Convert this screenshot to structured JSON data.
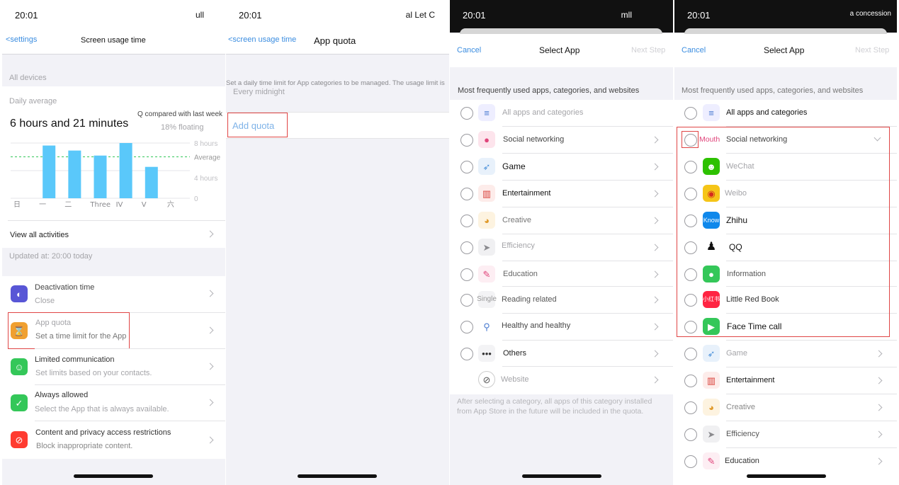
{
  "screen1": {
    "time": "20:01",
    "signal": "ull",
    "back_label": "<settings",
    "title": "Screen usage time",
    "section_label": "All devices",
    "daily_average_label": "Daily average",
    "compare_label": "Q compared with last week",
    "total_time": "6 hours and 21 minutes",
    "floating_label": "18% floating",
    "view_all_label": "View all activities",
    "updated_label": "Updated at: 20:00 today",
    "items": [
      {
        "title": "Deactivation time",
        "subtitle": "Close"
      },
      {
        "title": "App quota",
        "subtitle": "Set a time limit for the App"
      },
      {
        "title": "Limited communication",
        "subtitle": "Set limits based on your contacts."
      },
      {
        "title": "Always allowed",
        "subtitle": "Select the App that is always available."
      },
      {
        "title": "Content and privacy access restrictions",
        "subtitle": "Block inappropriate content."
      }
    ],
    "colors": {
      "accent": "#5ac8fa",
      "bar": "#5ac8fa",
      "average_line": "#34c759",
      "red_box": "#e04545"
    }
  },
  "chart_data": {
    "type": "bar",
    "categories": [
      "日",
      "一",
      "二",
      "Three",
      "IV",
      "V",
      "六"
    ],
    "values": [
      0,
      4.2,
      3.8,
      3.4,
      4.4,
      2.5,
      0
    ],
    "average": 3.3,
    "ylim": [
      0,
      4
    ],
    "ytick_labels": [
      "8 hours",
      "Average",
      "4 hours",
      "0"
    ]
  },
  "screen2": {
    "time": "20:01",
    "signal": "al Let C",
    "back_label": "<screen usage time",
    "title": "App quota",
    "description": "Set a daily time limit for App categories to be managed. The usage limit is",
    "reset_label": "Every midnight",
    "add_quota_label": "Add quota"
  },
  "screen3": {
    "time": "20:01",
    "signal": "mll",
    "cancel_label": "Cancel",
    "title": "Select App",
    "next_label": "Next Step",
    "section_header": "Most frequently used apps, categories, and websites",
    "rows": [
      {
        "label": "All apps and categories",
        "icon": "stack-icon"
      },
      {
        "label": "Social networking",
        "icon": "chat-bubble-icon"
      },
      {
        "label": "Game",
        "icon": "rocket-icon"
      },
      {
        "label": "Entertainment",
        "icon": "popcorn-icon"
      },
      {
        "label": "Creative",
        "icon": "palette-icon"
      },
      {
        "label": "Efficiency",
        "icon": "paper-plane-icon"
      },
      {
        "label": "Education",
        "icon": "paint-icon"
      },
      {
        "label": "Reading related",
        "icon": "book-icon",
        "icon_text": "Single"
      },
      {
        "label": "Healthy and healthy",
        "icon": "bicycle-icon"
      },
      {
        "label": "Others",
        "icon": "more-icon"
      },
      {
        "label": "Website",
        "icon": "compass-icon"
      }
    ],
    "footer": "After selecting a category, all apps of this category installed from App Store in the future will be included in the quota."
  },
  "screen4": {
    "time": "20:01",
    "signal": "a concession",
    "cancel_label": "Cancel",
    "title": "Select App",
    "next_label": "Next Step",
    "section_header": "Most frequently used apps, categories, and websites",
    "mouth_label": "Mouth",
    "rows": [
      {
        "label": "All apps and categories",
        "icon": "stack-icon"
      },
      {
        "label": "Social networking",
        "icon": "chat-bubble-icon"
      },
      {
        "label": "WeChat",
        "icon": "wechat-icon"
      },
      {
        "label": "Weibo",
        "icon": "weibo-icon"
      },
      {
        "label": "Zhihu",
        "icon": "zhihu-icon",
        "icon_text": "Know"
      },
      {
        "label": "QQ",
        "icon": "qq-penguin-icon"
      },
      {
        "label": "Information",
        "icon": "message-icon"
      },
      {
        "label": "Little Red Book",
        "icon": "little-red-book-icon",
        "icon_text": "小红书"
      },
      {
        "label": "Face Time call",
        "icon": "facetime-icon"
      },
      {
        "label": "Game",
        "icon": "rocket-icon"
      },
      {
        "label": "Entertainment",
        "icon": "popcorn-icon"
      },
      {
        "label": "Creative",
        "icon": "palette-icon"
      },
      {
        "label": "Efficiency",
        "icon": "paper-plane-icon"
      },
      {
        "label": "Education",
        "icon": "paint-icon"
      }
    ]
  }
}
